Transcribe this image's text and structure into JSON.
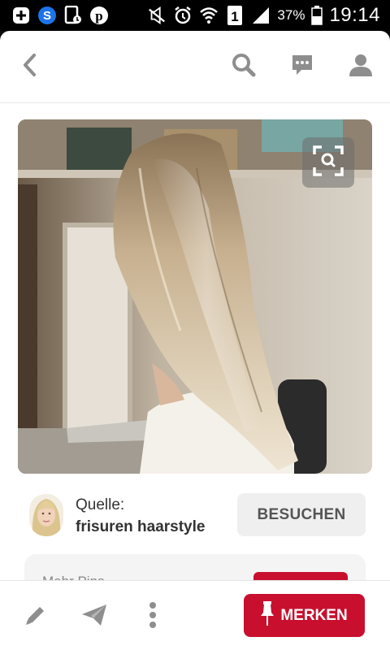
{
  "status_bar": {
    "battery_percent": "37%",
    "time": "19:14",
    "sim_slot": "1",
    "icons": [
      "add-notification-icon",
      "s-app-icon",
      "phone-notification-icon",
      "pinterest-icon",
      "mute-icon",
      "alarm-icon",
      "wifi-icon",
      "sim-icon",
      "signal-icon",
      "battery-icon"
    ]
  },
  "header": {
    "icons": [
      "back-icon",
      "search-icon",
      "messages-icon",
      "profile-icon"
    ]
  },
  "pin": {
    "image_alt": "long blonde straight hair",
    "zoom_icon": "visual-search-icon"
  },
  "source": {
    "label": "Quelle:",
    "name": "frisuren haarstyle",
    "visit_label": "BESUCHEN"
  },
  "peek": {
    "text": "Mehr Pins"
  },
  "bottom_bar": {
    "save_label": "MERKEN",
    "icons": [
      "edit-icon",
      "send-icon",
      "more-icon",
      "pin-icon"
    ]
  },
  "colors": {
    "brand_red": "#c8102e",
    "icon_gray": "#8e8e8e",
    "button_gray": "#efefef"
  }
}
